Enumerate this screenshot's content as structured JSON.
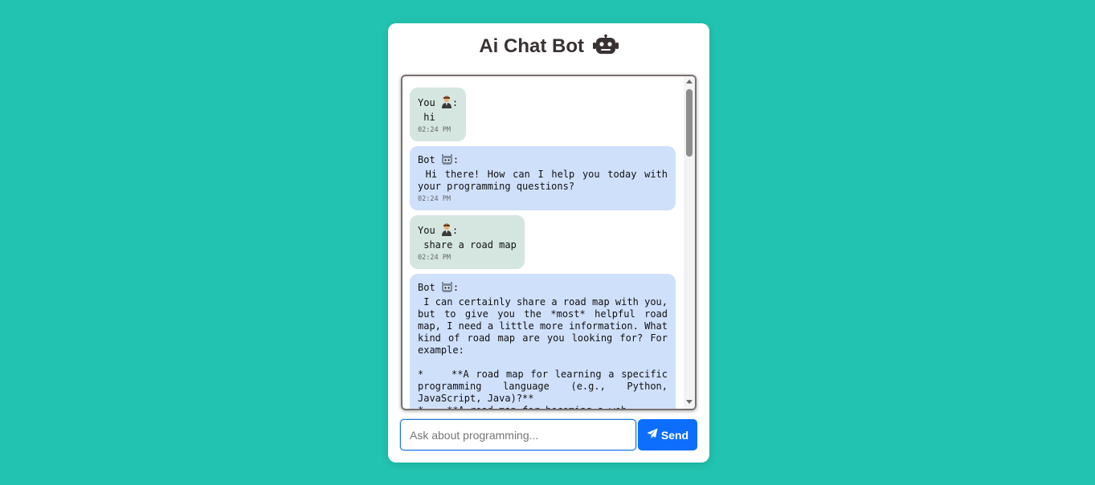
{
  "app": {
    "title": "Ai Chat Bot",
    "title_icon": "robot-icon"
  },
  "messages": [
    {
      "role": "user",
      "sender": "You",
      "sender_icon": "person-icon",
      "text": " hi",
      "time": "02:24 PM"
    },
    {
      "role": "bot",
      "sender": "Bot",
      "sender_icon": "bot-icon",
      "text": " Hi there! How can I help you today with your programming questions?",
      "time": "02:24 PM"
    },
    {
      "role": "user",
      "sender": "You",
      "sender_icon": "person-icon",
      "text": " share a road map",
      "time": "02:24 PM"
    },
    {
      "role": "bot",
      "sender": "Bot",
      "sender_icon": "bot-icon",
      "text": " I can certainly share a road map with you, but to give you the *most* helpful road map, I need a little more information. What kind of road map are you looking for? For example:\n\n*    **A road map for learning a specific programming language (e.g., Python, JavaScript, Java)?**\n*    **A road map for becoming a web",
      "time": ""
    }
  ],
  "input": {
    "placeholder": "Ask about programming...",
    "value": ""
  },
  "send_button": {
    "label": "Send",
    "icon": "paper-plane-icon"
  },
  "colors": {
    "background": "#22c3b0",
    "user_bubble": "#d4e6df",
    "bot_bubble": "#cfe0fb",
    "send_button": "#0d6efd"
  }
}
